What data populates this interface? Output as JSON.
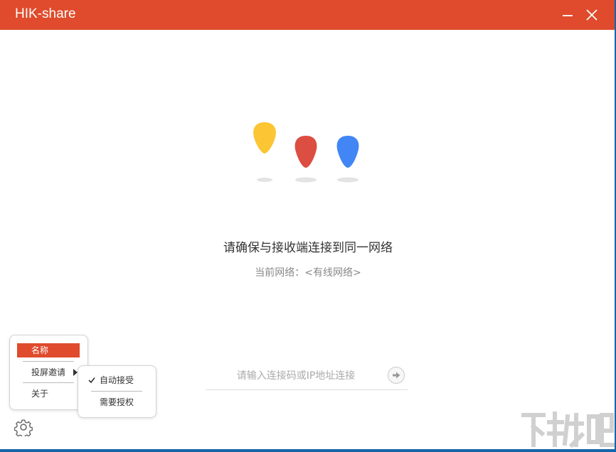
{
  "window": {
    "title": "HIK-share",
    "minimize_icon": "minimize-icon",
    "close_icon": "close-icon"
  },
  "colors": {
    "titlebar": "#df4b2c",
    "drop_yellow": "#fbc534",
    "drop_red": "#dc4e41",
    "drop_blue": "#4186f4",
    "menu_active": "#df4b2c"
  },
  "main": {
    "headline": "请确保与接收端连接到同一网络",
    "network_label": "当前网络：",
    "network_value": "<有线网络>"
  },
  "connect": {
    "placeholder": "请输入连接码或IP地址连接",
    "value": "",
    "go_icon": "arrow-right-circle-icon"
  },
  "menu": {
    "items": [
      {
        "label": "名称",
        "active": true
      },
      {
        "label": "投屏邀请",
        "has_submenu": true
      },
      {
        "label": "关于"
      }
    ],
    "submenu": [
      {
        "label": "自动接受",
        "checked": true
      },
      {
        "label": "需要授权",
        "checked": false
      }
    ]
  },
  "settings_icon": "gear-icon",
  "watermark": "下载吧"
}
